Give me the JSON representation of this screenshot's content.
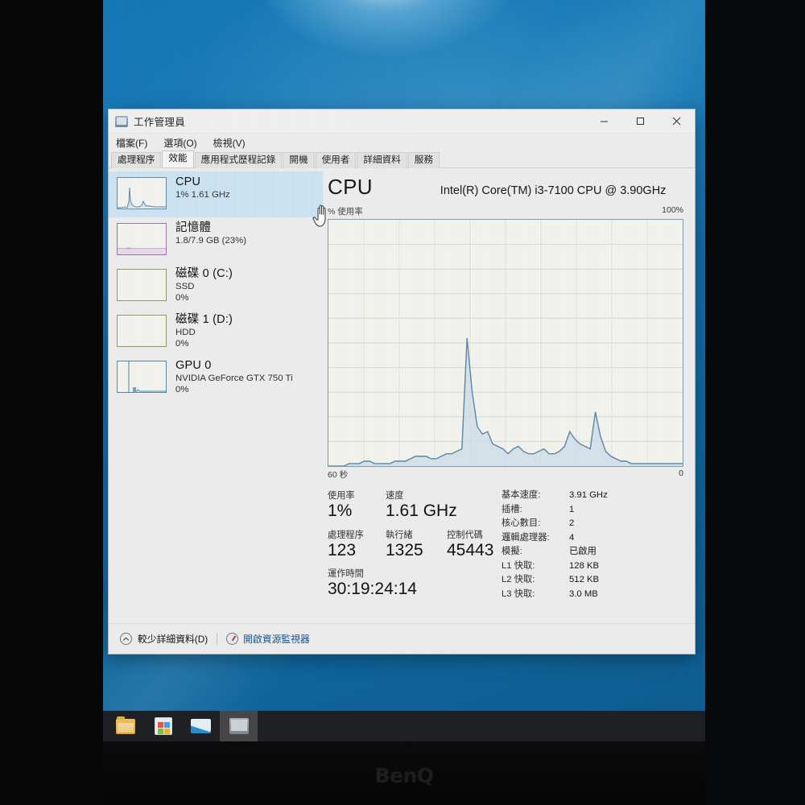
{
  "window": {
    "title": "工作管理員",
    "icon": "task-manager-icon",
    "controls": {
      "minimize": "–",
      "maximize": "□",
      "close": "✕"
    }
  },
  "menu": {
    "items": [
      {
        "label": "檔案(F)"
      },
      {
        "label": "選項(O)"
      },
      {
        "label": "檢視(V)"
      }
    ]
  },
  "tabs": [
    {
      "label": "處理程序",
      "active": false
    },
    {
      "label": "效能",
      "active": true
    },
    {
      "label": "應用程式歷程記錄",
      "active": false
    },
    {
      "label": "開機",
      "active": false
    },
    {
      "label": "使用者",
      "active": false
    },
    {
      "label": "詳細資料",
      "active": false
    },
    {
      "label": "服務",
      "active": false
    }
  ],
  "sidebar": {
    "items": [
      {
        "title": "CPU",
        "sub1": "1%  1.61 GHz",
        "sub2": "",
        "selected": true
      },
      {
        "title": "記憶體",
        "sub1": "1.8/7.9 GB (23%)",
        "sub2": "",
        "selected": false
      },
      {
        "title": "磁碟 0 (C:)",
        "sub1": "SSD",
        "sub2": "0%",
        "selected": false
      },
      {
        "title": "磁碟 1 (D:)",
        "sub1": "HDD",
        "sub2": "0%",
        "selected": false
      },
      {
        "title": "GPU 0",
        "sub1": "NVIDIA GeForce GTX 750 Ti",
        "sub2": "0%",
        "selected": false
      }
    ]
  },
  "main": {
    "heading": "CPU",
    "model": "Intel(R) Core(TM) i3-7100 CPU @ 3.90GHz",
    "graph_y_label": "% 使用率",
    "graph_y_max": "100%",
    "graph_x_left": "60 秒",
    "graph_x_right": "0",
    "stats": {
      "utilization_label": "使用率",
      "utilization_value": "1%",
      "speed_label": "速度",
      "speed_value": "1.61 GHz",
      "processes_label": "處理程序",
      "processes_value": "123",
      "threads_label": "執行緒",
      "threads_value": "1325",
      "handles_label": "控制代碼",
      "handles_value": "45443",
      "uptime_label": "運作時間",
      "uptime_value": "30:19:24:14"
    },
    "specs": [
      {
        "key": "基本速度:",
        "value": "3.91 GHz"
      },
      {
        "key": "插槽:",
        "value": "1"
      },
      {
        "key": "核心數目:",
        "value": "2"
      },
      {
        "key": "邏輯處理器:",
        "value": "4"
      },
      {
        "key": "模擬:",
        "value": "已啟用"
      },
      {
        "key": "L1 快取:",
        "value": "128 KB"
      },
      {
        "key": "L2 快取:",
        "value": "512 KB"
      },
      {
        "key": "L3 快取:",
        "value": "3.0 MB"
      }
    ]
  },
  "footer": {
    "fewer_details": "較少詳細資料(D)",
    "resource_monitor": "開啟資源監視器"
  },
  "taskbar": {
    "buttons": [
      {
        "name": "file-explorer",
        "active": false
      },
      {
        "name": "microsoft-store",
        "active": false
      },
      {
        "name": "mail",
        "active": false
      },
      {
        "name": "task-manager",
        "active": true
      }
    ]
  },
  "monitor": {
    "brand": "BenQ"
  },
  "colors": {
    "accent": "#12508f",
    "selection": "#cde6f7",
    "graph_line": "#5a87a8",
    "graph_fill": "#cfe0ec",
    "wallpaper": "#0b6ba8"
  },
  "chart_data": {
    "type": "area",
    "title": "CPU 使用率",
    "ylabel": "% 使用率",
    "xlabel": "60 秒",
    "ylim": [
      0,
      100
    ],
    "xlim": [
      60,
      0
    ],
    "grid": true,
    "grid_cols": 10,
    "grid_rows": 10,
    "legend": "none",
    "values": [
      0,
      0,
      0,
      0,
      1,
      1,
      1,
      2,
      2,
      1,
      1,
      1,
      1,
      2,
      2,
      2,
      3,
      4,
      4,
      4,
      3,
      3,
      4,
      5,
      5,
      6,
      7,
      52,
      30,
      16,
      13,
      14,
      9,
      8,
      7,
      5,
      7,
      8,
      6,
      5,
      5,
      6,
      7,
      5,
      5,
      6,
      8,
      14,
      11,
      9,
      8,
      7,
      22,
      12,
      6,
      4,
      3,
      2,
      2,
      1,
      1,
      1,
      1,
      1,
      1,
      1,
      1,
      1,
      1,
      1
    ]
  }
}
